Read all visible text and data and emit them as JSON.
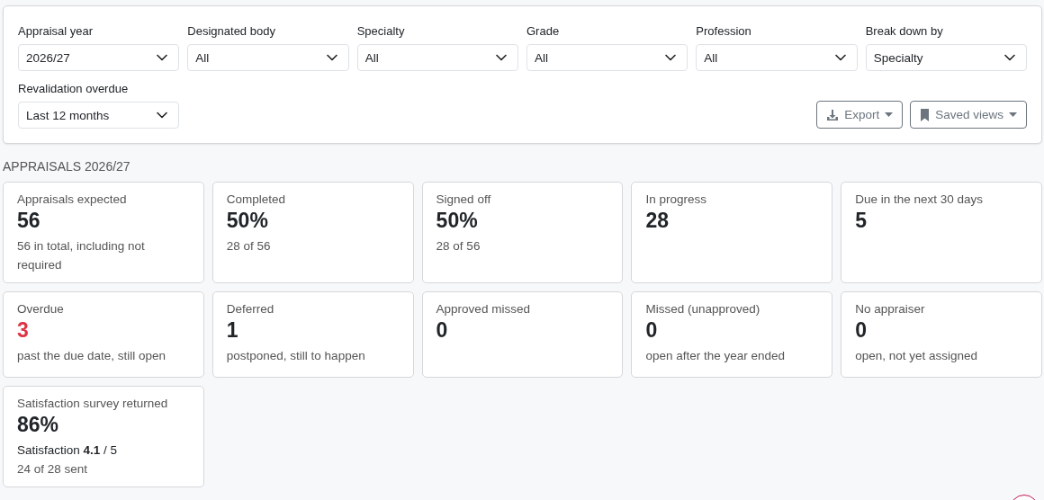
{
  "filters": [
    {
      "label": "Appraisal year",
      "value": "2026/27"
    },
    {
      "label": "Designated body",
      "value": "All"
    },
    {
      "label": "Specialty",
      "value": "All"
    },
    {
      "label": "Grade",
      "value": "All"
    },
    {
      "label": "Profession",
      "value": "All"
    },
    {
      "label": "Break down by",
      "value": "Specialty"
    },
    {
      "label": "Revalidation overdue",
      "value": "Last 12 months"
    }
  ],
  "actions": [
    {
      "label": "Export",
      "kind": "export"
    },
    {
      "label": "Saved views",
      "kind": "views"
    }
  ],
  "section_title": "APPRAISALS 2026/27",
  "cards": [
    {
      "title": "Appraisals expected",
      "value": "56",
      "alert": false,
      "notes": [
        "56 in total, including not required"
      ]
    },
    {
      "title": "Completed",
      "value": "50%",
      "alert": false,
      "notes": [
        "28 of 56"
      ]
    },
    {
      "title": "Signed off",
      "value": "50%",
      "alert": false,
      "notes": [
        "28 of 56"
      ]
    },
    {
      "title": "In progress",
      "value": "28",
      "alert": false
    },
    {
      "title": "Due in the next 30 days",
      "value": "5",
      "alert": false
    },
    {
      "title": "Overdue",
      "value": "3",
      "alert": true,
      "notes": [
        "past the due date, still open"
      ]
    },
    {
      "title": "Deferred",
      "value": "1",
      "alert": false,
      "notes": [
        "postponed, still to happen"
      ]
    },
    {
      "title": "Approved missed",
      "value": "0",
      "alert": false
    },
    {
      "title": "Missed (unapproved)",
      "value": "0",
      "alert": false,
      "notes": [
        "open after the year ended"
      ]
    },
    {
      "title": "No appraiser",
      "value": "0",
      "alert": false,
      "notes": [
        "open, not yet assigned"
      ]
    },
    {
      "title": "Satisfaction survey returned",
      "value": "86%",
      "alert": false,
      "rating": "Satisfaction **4.1** / 5",
      "notes": [
        "24 of 28 sent"
      ]
    }
  ]
}
